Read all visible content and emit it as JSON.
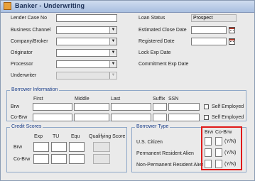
{
  "window": {
    "title": "Banker - Underwriting"
  },
  "left_form": {
    "lender_case_no_label": "Lender Case No",
    "business_channel_label": "Business Channel",
    "company_broker_label": "Company/Broker",
    "originator_label": "Originator",
    "processor_label": "Processor",
    "underwriter_label": "Underwriter"
  },
  "right_form": {
    "loan_status_label": "Loan Status",
    "loan_status_value": "Prospect",
    "estimated_close_date_label": "Estimated Close Date",
    "registered_date_label": "Registered Date",
    "lock_exp_date_label": "Lock Exp Date",
    "commitment_exp_date_label": "Commitment Exp Date"
  },
  "borrower_info": {
    "title": "Borrower Information",
    "col_first": "First",
    "col_middle": "Middle",
    "col_last": "Last",
    "col_suffix": "Suffix",
    "col_ssn": "SSN",
    "row_brw": "Brw",
    "row_cobrw": "Co-Brw",
    "self_employed_label": "Self Employed"
  },
  "credit_scores": {
    "title": "Credit Scores",
    "col_exp": "Exp",
    "col_tu": "TU",
    "col_equ": "Equ",
    "col_qualifying": "Qualifying Score",
    "row_brw": "Brw",
    "row_cobrw": "Co-Brw"
  },
  "borrower_type": {
    "title": "Borrower Type",
    "col_brw": "Brw",
    "col_cobrw": "Co-Brw",
    "rows": [
      {
        "label": "U.S. Citizen",
        "hint": "(Y/N)"
      },
      {
        "label": "Permanent Resident Alien",
        "hint": "(Y/N)"
      },
      {
        "label": "Non-Permanent Resident Alien",
        "hint": "(Y/N)"
      }
    ]
  },
  "colors": {
    "highlight": "#e01a1a",
    "group_title": "#1b3f8b",
    "titlebar": "#a9bfe0"
  }
}
